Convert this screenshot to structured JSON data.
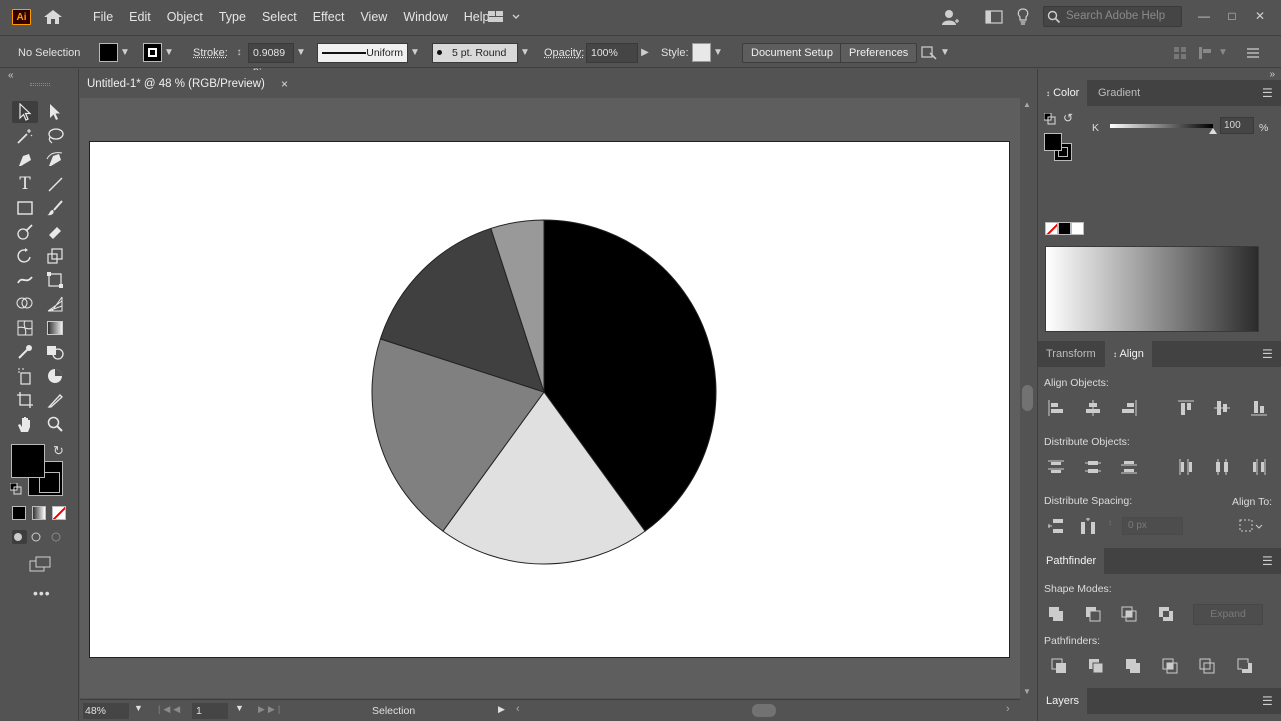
{
  "app": {
    "logo_text": "Ai"
  },
  "menu": [
    "File",
    "Edit",
    "Object",
    "Type",
    "Select",
    "Effect",
    "View",
    "Window",
    "Help"
  ],
  "search": {
    "placeholder": "Search Adobe Help"
  },
  "control_bar": {
    "selection": "No Selection",
    "stroke_label": "Stroke:",
    "stroke_value": "0.9089 p:",
    "profile": "Uniform",
    "brush": "5 pt. Round",
    "opacity_label": "Opacity:",
    "opacity_value": "100%",
    "style_label": "Style:",
    "document_setup": "Document Setup",
    "preferences": "Preferences"
  },
  "document": {
    "tab_title": "Untitled-1* @ 48 % (RGB/Preview)",
    "close": "×"
  },
  "pie": {
    "slices": [
      {
        "value": 40,
        "color": "#000000"
      },
      {
        "value": 20,
        "color": "#e0e0e0"
      },
      {
        "value": 20,
        "color": "#808080"
      },
      {
        "value": 15,
        "color": "#404040"
      },
      {
        "value": 5,
        "color": "#999999"
      }
    ]
  },
  "status": {
    "zoom": "48%",
    "artboard": "1",
    "tool": "Selection"
  },
  "panels": {
    "color_tab": "Color",
    "gradient_tab": "Gradient",
    "k_label": "K",
    "k_value": "100",
    "k_percent": "%",
    "k_level": 1.0,
    "transform_tab": "Transform",
    "align_tab": "Align",
    "align_objects": "Align Objects:",
    "distribute_objects": "Distribute Objects:",
    "distribute_spacing": "Distribute Spacing:",
    "align_to": "Align To:",
    "spacing_value": "0 px",
    "pathfinder_tab": "Pathfinder",
    "shape_modes": "Shape Modes:",
    "expand": "Expand",
    "pathfinders": "Pathfinders:",
    "layers_tab": "Layers"
  }
}
